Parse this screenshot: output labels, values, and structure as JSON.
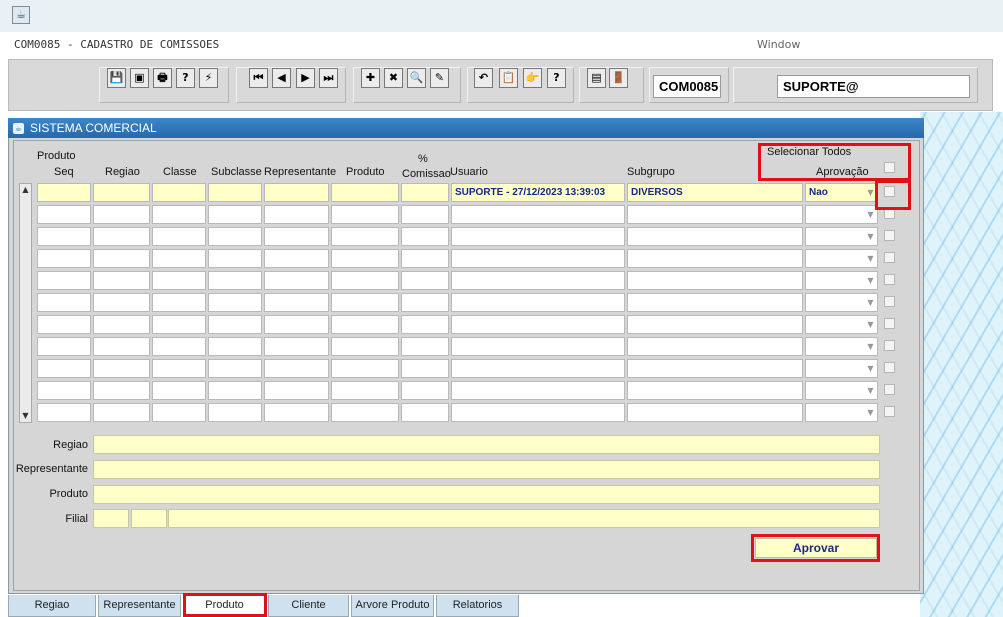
{
  "window": {
    "app_icon": "java-icon",
    "form_title": "COM0085 - CADASTRO DE COMISSOES",
    "menu": "Window"
  },
  "toolbar": {
    "icons": [
      "save-icon",
      "window-icon",
      "print-icon",
      "help-query-icon",
      "execute-query-icon",
      "first-record-icon",
      "previous-record-icon",
      "next-record-icon",
      "last-record-icon",
      "insert-record-icon",
      "delete-record-icon",
      "search-record-icon",
      "clear-icon",
      "undo-icon",
      "clipboard-icon",
      "list-values-icon",
      "help-icon",
      "menu-icon",
      "exit-icon"
    ],
    "icon_glyphs": [
      "💾",
      "▣",
      "🖶",
      "?",
      "⚡",
      "⏮",
      "◀",
      "▶",
      "⏭",
      "✚",
      "✖",
      "🔍",
      "✎",
      "↶",
      "📋",
      "👉",
      "?",
      "▤",
      "🚪"
    ],
    "menu_label": "Menu",
    "form_code": "COM0085",
    "user": "SUPORTE@"
  },
  "panel": {
    "title": "SISTEMA COMERCIAL",
    "columns": {
      "produto_top": "Produto",
      "seq": "Seq",
      "regiao": "Regiao",
      "classe": "Classe",
      "subclasse": "Subclasse",
      "representante": "Representante",
      "produto": "Produto",
      "pct_top": "%",
      "comissao": "Comissao",
      "usuario": "Usuario",
      "subgrupo": "Subgrupo",
      "selecionar_todos": "Selecionar Todos",
      "aprovacao": "Aprovação"
    },
    "rows": [
      {
        "usuario": "SUPORTE - 27/12/2023 13:39:03",
        "subgrupo": "DIVERSOS",
        "aprovacao": "Nao"
      },
      {
        "usuario": "",
        "subgrupo": "",
        "aprovacao": ""
      },
      {
        "usuario": "",
        "subgrupo": "",
        "aprovacao": ""
      },
      {
        "usuario": "",
        "subgrupo": "",
        "aprovacao": ""
      },
      {
        "usuario": "",
        "subgrupo": "",
        "aprovacao": ""
      },
      {
        "usuario": "",
        "subgrupo": "",
        "aprovacao": ""
      },
      {
        "usuario": "",
        "subgrupo": "",
        "aprovacao": ""
      },
      {
        "usuario": "",
        "subgrupo": "",
        "aprovacao": ""
      },
      {
        "usuario": "",
        "subgrupo": "",
        "aprovacao": ""
      },
      {
        "usuario": "",
        "subgrupo": "",
        "aprovacao": ""
      },
      {
        "usuario": "",
        "subgrupo": "",
        "aprovacao": ""
      }
    ],
    "detail": {
      "regiao": "Regiao",
      "representante": "Representante",
      "produto": "Produto",
      "filial": "Filial"
    },
    "aprovar": "Aprovar"
  },
  "tabs": [
    "Regiao",
    "Representante",
    "Produto",
    "Cliente",
    "Arvore Produto",
    "Relatorios"
  ],
  "active_tab": "Produto",
  "colors": {
    "header_blue": "#2569ad",
    "field_yellow": "#ffffc8",
    "highlight_red": "#e01018"
  }
}
